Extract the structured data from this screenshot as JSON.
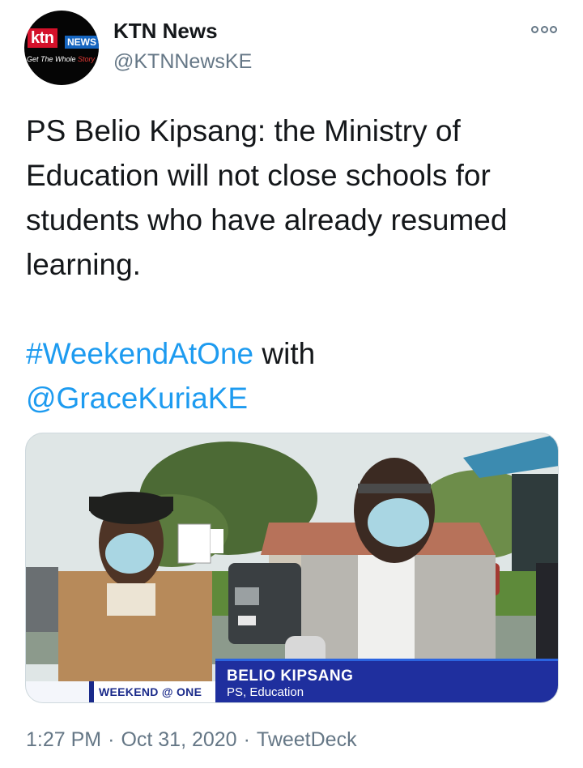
{
  "author": {
    "display_name": "KTN News",
    "handle": "@KTNNewsKE",
    "avatar": {
      "logo_text": "ktn",
      "logo_badge": "NEWS",
      "tagline_prefix": "Get The Whole ",
      "tagline_highlight": "Story",
      "brand_red": "#d4112a",
      "brand_blue": "#1565c0"
    }
  },
  "more_icon": "more-options-icon",
  "tweet": {
    "text": "PS Belio Kipsang: the Ministry of Education will not close schools for students who have already resumed learning.",
    "hashtag": "#WeekendAtOne",
    "connector": " with",
    "mention": "@GraceKuriaKE"
  },
  "media": {
    "lower_third": {
      "show_name": "WEEKEND @ ONE",
      "person_name": "BELIO KIPSANG",
      "person_role": "PS, Education"
    }
  },
  "meta": {
    "time": "1:27 PM",
    "separator": "·",
    "date": "Oct 31, 2020",
    "source": "TweetDeck"
  },
  "colors": {
    "link": "#1d9bf0",
    "secondary_text": "#657786",
    "primary_text": "#14171a"
  }
}
